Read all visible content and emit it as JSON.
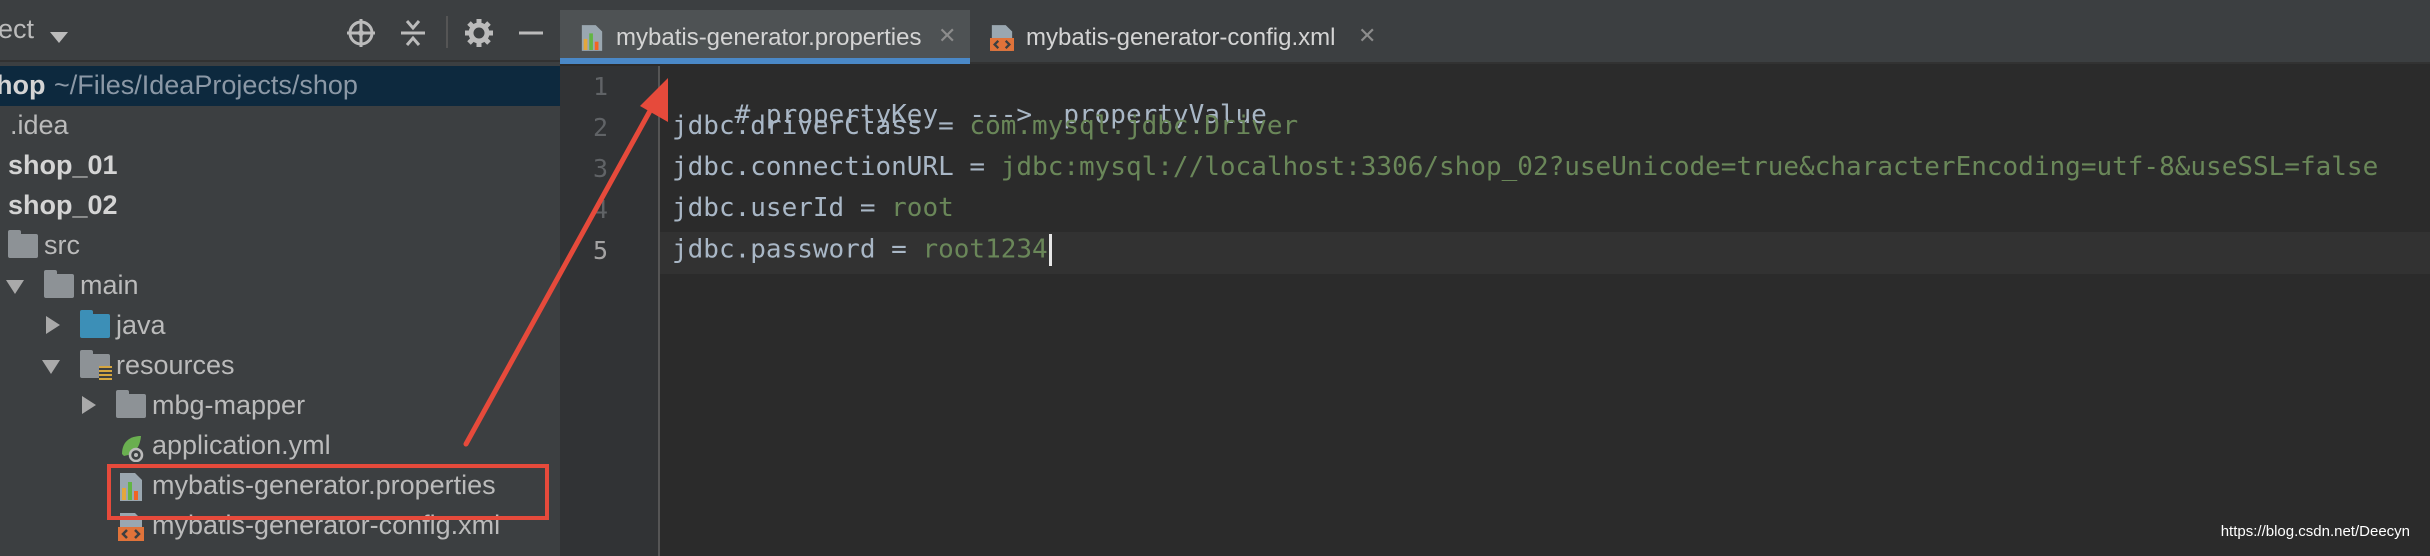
{
  "sidebar": {
    "header_label": "ect",
    "tree": [
      {
        "label": "hop",
        "suffix": "~/Files/IdeaProjects/shop",
        "selected": true
      },
      {
        "label": ".idea"
      },
      {
        "label": "shop_01"
      },
      {
        "label": "shop_02"
      },
      {
        "label": "src"
      },
      {
        "label": "main"
      },
      {
        "label": "java"
      },
      {
        "label": "resources"
      },
      {
        "label": "mbg-mapper"
      },
      {
        "label": "application.yml"
      },
      {
        "label": "mybatis-generator.properties",
        "highlighted": true
      },
      {
        "label": "mybatis-generator-config.xml"
      }
    ]
  },
  "tabs": [
    {
      "label": "mybatis-generator.properties",
      "active": true,
      "icon": "properties-file-icon"
    },
    {
      "label": "mybatis-generator-config.xml",
      "active": false,
      "icon": "xml-file-icon"
    }
  ],
  "editor": {
    "line_numbers": [
      "1",
      "2",
      "3",
      "4",
      "5"
    ],
    "current_line": 5,
    "lines": [
      {
        "comment": "# propertyKey  --->  propertyValue"
      },
      {
        "key": "jdbc.driverClass",
        "sep": " = ",
        "value": "com.mysql.jdbc.Driver"
      },
      {
        "key": "jdbc.connectionURL",
        "sep": " = ",
        "value": "jdbc:mysql://localhost:3306/shop_02?useUnicode=true&characterEncoding=utf-8&useSSL=false"
      },
      {
        "key": "jdbc.userId",
        "sep": " = ",
        "value": "root"
      },
      {
        "key": "jdbc.password",
        "sep": " = ",
        "value": "root1234"
      }
    ]
  },
  "colors": {
    "annotation": "#e64a3b",
    "value_text": "#6a8759",
    "key_text": "#a9b7c6",
    "active_tab_underline": "#4a88c7"
  },
  "watermark": "https://blog.csdn.net/Deecyn"
}
